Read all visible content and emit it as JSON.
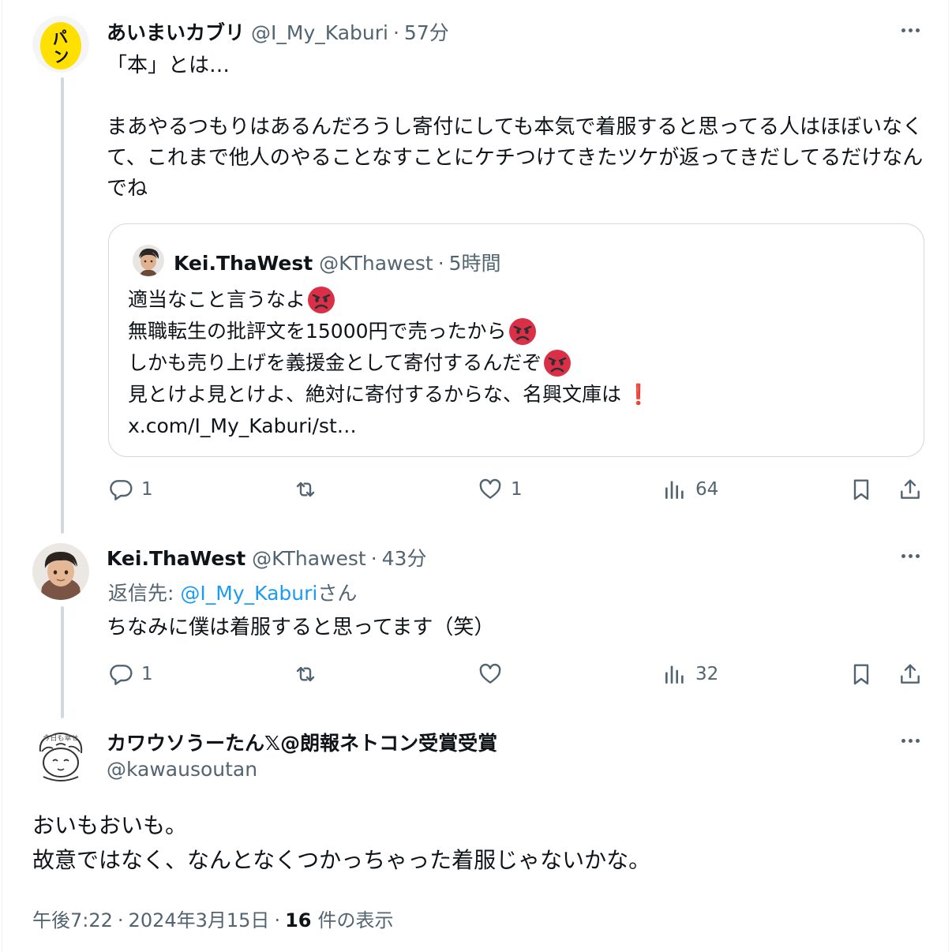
{
  "tweets": [
    {
      "author": "あいまいカブリ",
      "handle": "@I_My_Kaburi",
      "time": "57分",
      "avatar_text": "パン",
      "text": "「本」とは…\n\nまあやるつもりはあるんだろうし寄付にしても本気で着服すると思ってる人はほぼいなくて、これまで他人のやることなすことにケチつけてきたツケが返ってきだしてるだけなんでね",
      "quote": {
        "author": "Kei.ThaWest",
        "handle": "@KThawest",
        "time": "5時間",
        "lines": [
          "適当なこと言うなよ",
          "無職転生の批評文を15000円で売ったから",
          "しかも売り上げを義援金として寄付するんだぞ",
          "見とけよ見とけよ、絶対に寄付するからな、名興文庫は",
          "x.com/I_My_Kaburi/st…"
        ],
        "exclamation": "❗"
      },
      "actions": {
        "reply_count": "1",
        "retweet_count": "",
        "like_count": "1",
        "view_count": "64"
      }
    },
    {
      "author": "Kei.ThaWest",
      "handle": "@KThawest",
      "time": "43分",
      "reply_prefix": "返信先: ",
      "reply_handle": "@I_My_Kaburi",
      "reply_suffix": "さん",
      "text": "ちなみに僕は着服すると思ってます（笑）",
      "actions": {
        "reply_count": "1",
        "retweet_count": "",
        "like_count": "",
        "view_count": "32"
      }
    },
    {
      "author": "カワウソうーたん𝕏@朗報ネトコン受賞受賞",
      "handle": "@kawausoutan",
      "avatar_text": "今日も幸せ",
      "text": "おいもおいも。\n故意ではなく、なんとなくつかっちゃった着服じゃないかな。",
      "meta": {
        "time": "午後7:22",
        "date": "2024年3月15日",
        "views": "16",
        "views_label": "件の表示"
      }
    }
  ],
  "colors": {
    "accent": "#1d9bf0",
    "muted": "#536471",
    "border": "#cfd9de",
    "avatar_yellow": "#ffe000"
  }
}
